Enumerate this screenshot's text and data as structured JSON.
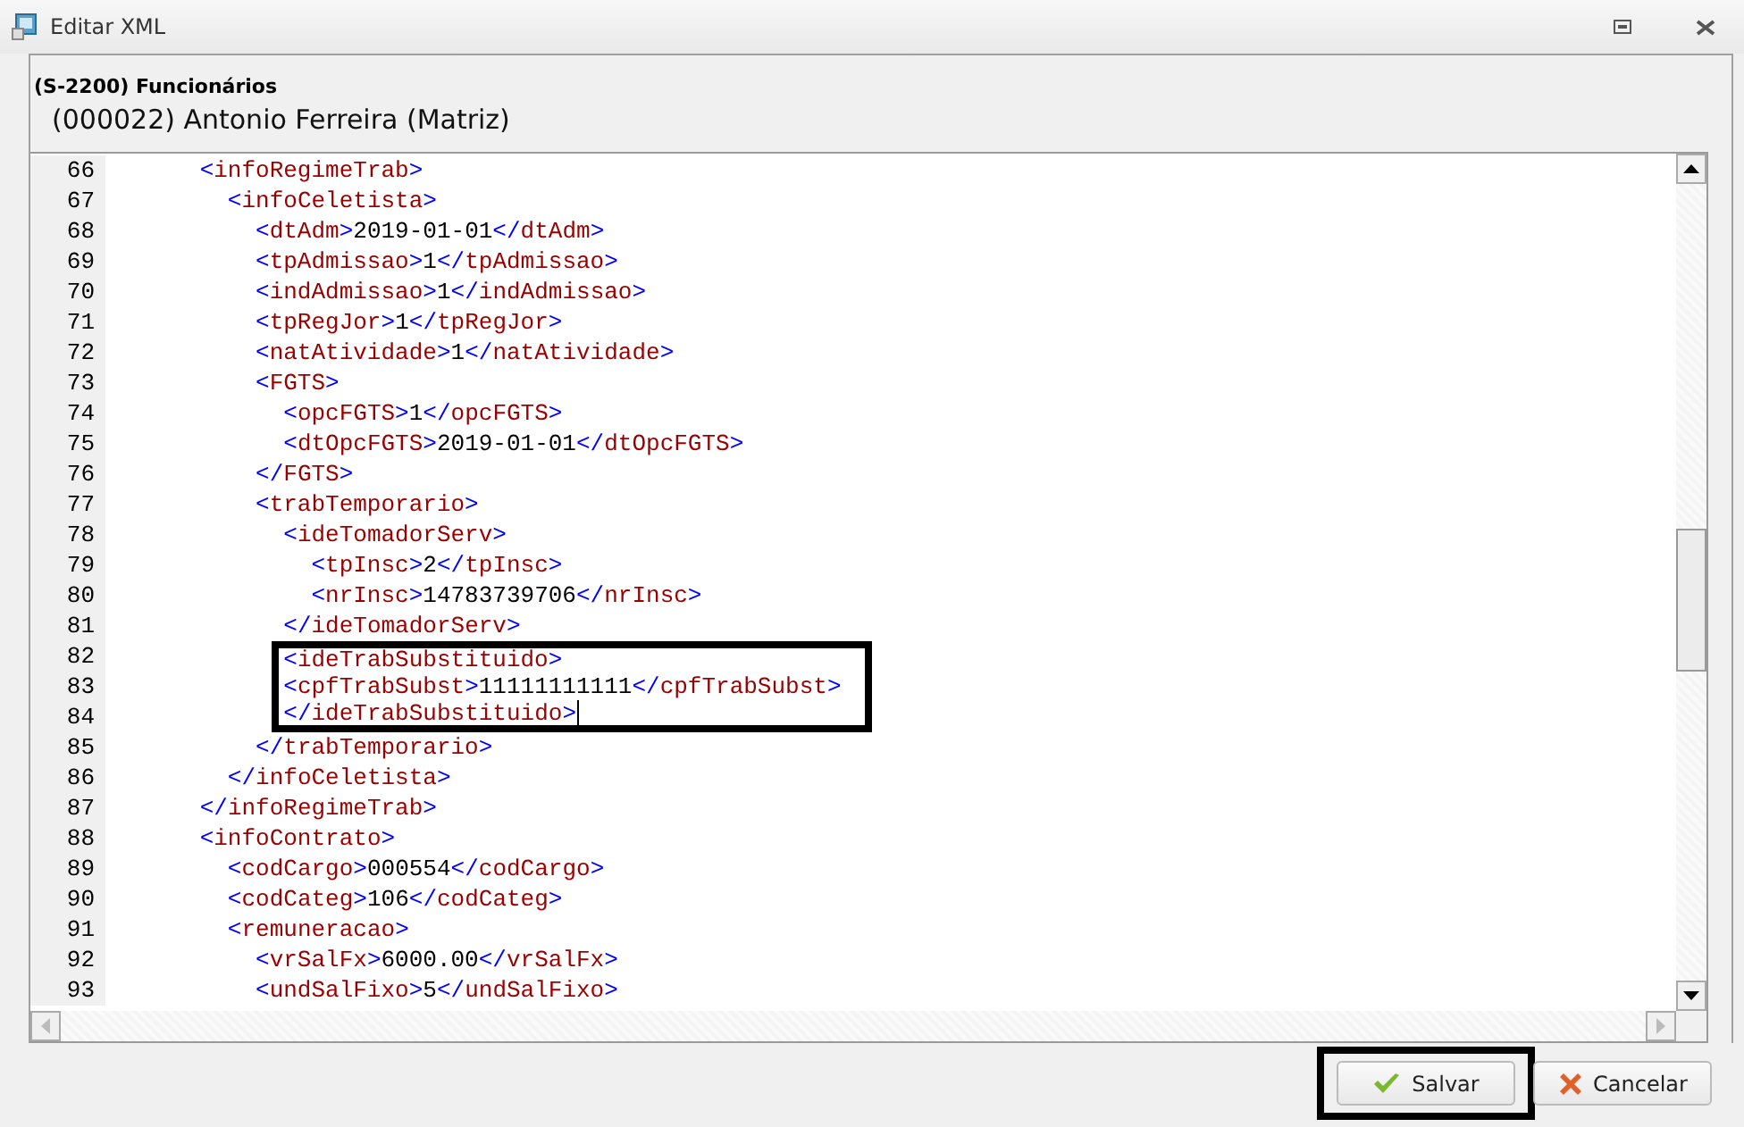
{
  "window": {
    "title": "Editar XML"
  },
  "header": {
    "event": "(S-2200) Funcionários",
    "employee": "(000022) Antonio Ferreira (Matriz)"
  },
  "editor": {
    "lines": [
      {
        "number": "66",
        "text": "      <infoRegimeTrab>",
        "highlighted": false,
        "caret": false
      },
      {
        "number": "67",
        "text": "        <infoCeletista>",
        "highlighted": false,
        "caret": false
      },
      {
        "number": "68",
        "text": "          <dtAdm>2019-01-01</dtAdm>",
        "highlighted": false,
        "caret": false
      },
      {
        "number": "69",
        "text": "          <tpAdmissao>1</tpAdmissao>",
        "highlighted": false,
        "caret": false
      },
      {
        "number": "70",
        "text": "          <indAdmissao>1</indAdmissao>",
        "highlighted": false,
        "caret": false
      },
      {
        "number": "71",
        "text": "          <tpRegJor>1</tpRegJor>",
        "highlighted": false,
        "caret": false
      },
      {
        "number": "72",
        "text": "          <natAtividade>1</natAtividade>",
        "highlighted": false,
        "caret": false
      },
      {
        "number": "73",
        "text": "          <FGTS>",
        "highlighted": false,
        "caret": false
      },
      {
        "number": "74",
        "text": "            <opcFGTS>1</opcFGTS>",
        "highlighted": false,
        "caret": false
      },
      {
        "number": "75",
        "text": "            <dtOpcFGTS>2019-01-01</dtOpcFGTS>",
        "highlighted": false,
        "caret": false
      },
      {
        "number": "76",
        "text": "          </FGTS>",
        "highlighted": false,
        "caret": false
      },
      {
        "number": "77",
        "text": "          <trabTemporario>",
        "highlighted": false,
        "caret": false
      },
      {
        "number": "78",
        "text": "            <ideTomadorServ>",
        "highlighted": false,
        "caret": false
      },
      {
        "number": "79",
        "text": "              <tpInsc>2</tpInsc>",
        "highlighted": false,
        "caret": false
      },
      {
        "number": "80",
        "text": "              <nrInsc>14783739706</nrInsc>",
        "highlighted": false,
        "caret": false
      },
      {
        "number": "81",
        "text": "            </ideTomadorServ>",
        "highlighted": false,
        "caret": false
      },
      {
        "number": "82",
        "text": "            <ideTrabSubstituido>",
        "highlighted": true,
        "caret": false
      },
      {
        "number": "83",
        "text": "            <cpfTrabSubst>11111111111</cpfTrabSubst>",
        "highlighted": true,
        "caret": false
      },
      {
        "number": "84",
        "text": "            </ideTrabSubstituido>",
        "highlighted": true,
        "caret": true
      },
      {
        "number": "85",
        "text": "          </trabTemporario>",
        "highlighted": false,
        "caret": false
      },
      {
        "number": "86",
        "text": "        </infoCeletista>",
        "highlighted": false,
        "caret": false
      },
      {
        "number": "87",
        "text": "      </infoRegimeTrab>",
        "highlighted": false,
        "caret": false
      },
      {
        "number": "88",
        "text": "      <infoContrato>",
        "highlighted": false,
        "caret": false
      },
      {
        "number": "89",
        "text": "        <codCargo>000554</codCargo>",
        "highlighted": false,
        "caret": false
      },
      {
        "number": "90",
        "text": "        <codCateg>106</codCateg>",
        "highlighted": false,
        "caret": false
      },
      {
        "number": "91",
        "text": "        <remuneracao>",
        "highlighted": false,
        "caret": false
      },
      {
        "number": "92",
        "text": "          <vrSalFx>6000.00</vrSalFx>",
        "highlighted": false,
        "caret": false
      },
      {
        "number": "93",
        "text": "          <undSalFixo>5</undSalFixo>",
        "highlighted": false,
        "caret": false
      }
    ]
  },
  "buttons": [
    {
      "kind": "save",
      "label": "Salvar",
      "highlighted": true
    },
    {
      "kind": "cancel",
      "label": "Cancelar",
      "highlighted": false
    }
  ]
}
